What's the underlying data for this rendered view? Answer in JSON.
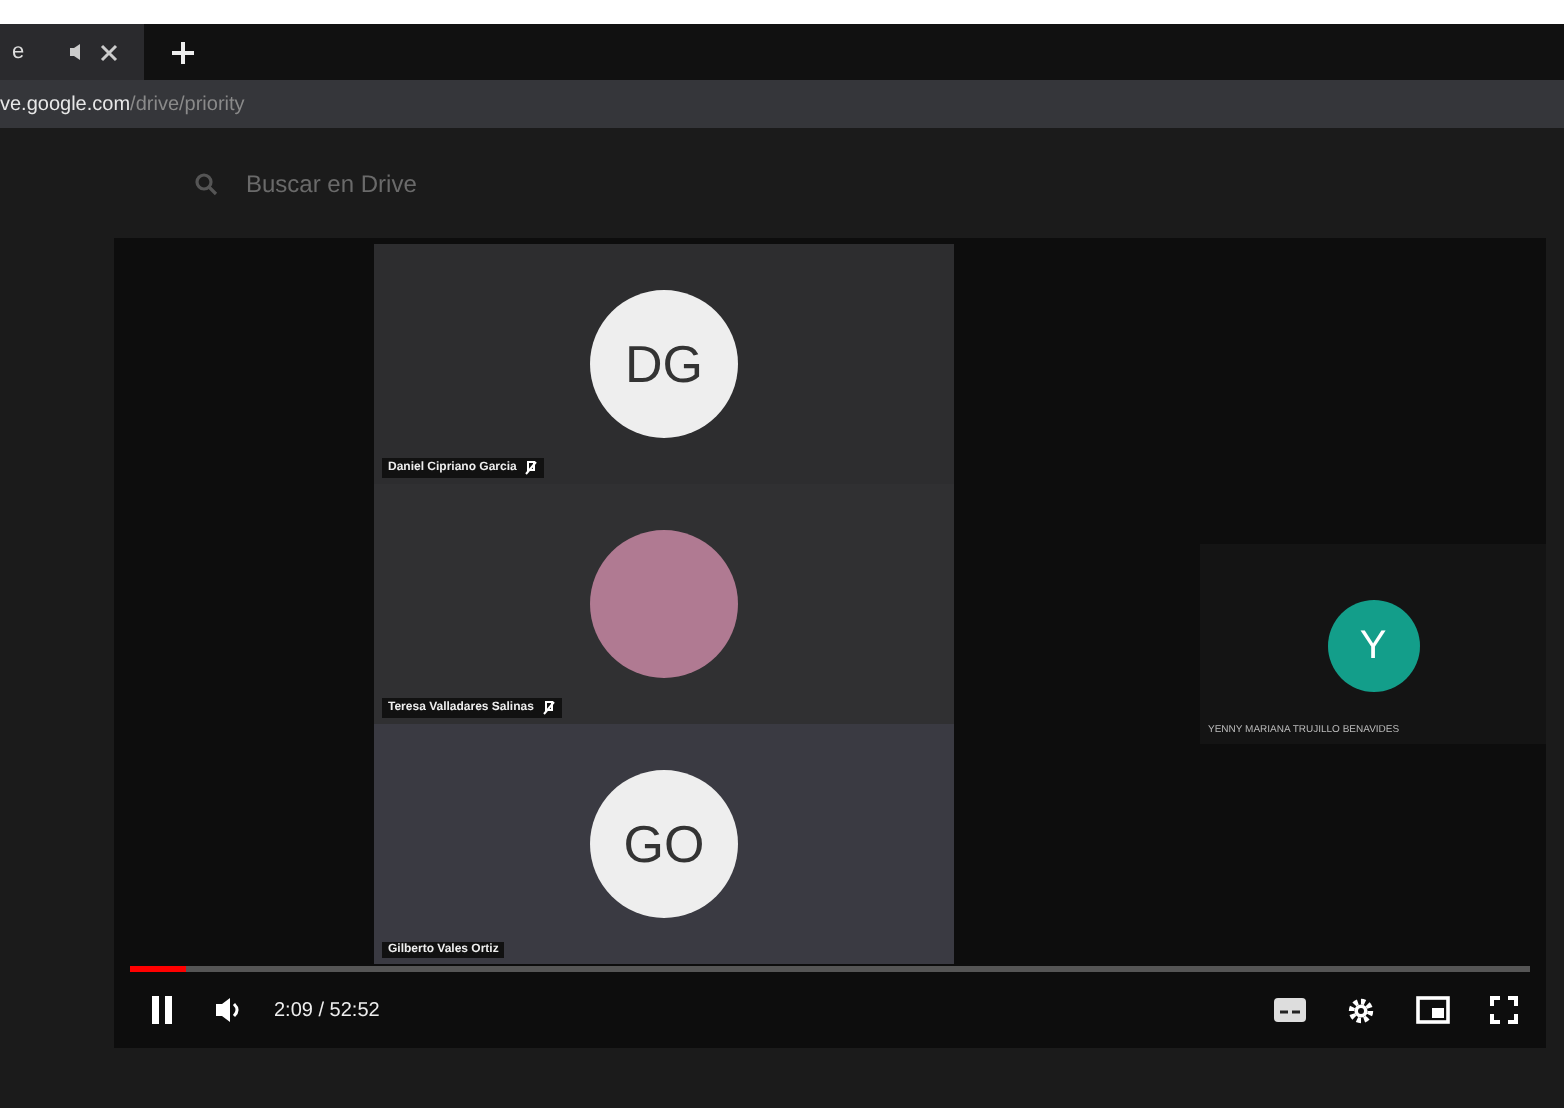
{
  "browser": {
    "tab_title": "e",
    "url_host": "ve.google.com",
    "url_path": "/drive/priority"
  },
  "drive": {
    "search_placeholder": "Buscar en Drive"
  },
  "video": {
    "tiles": [
      {
        "kind": "initials",
        "initials": "DG",
        "name": "Daniel Cipriano Garcia",
        "muted": true
      },
      {
        "kind": "photo",
        "name": "Teresa Valladares Salinas",
        "muted": true
      },
      {
        "kind": "initials",
        "initials": "GO",
        "name": "Gilberto Vales Ortiz",
        "muted": false
      }
    ],
    "side_tile": {
      "initials": "Y",
      "name": "YENNY MARIANA TRUJILLO BENAVIDES",
      "color": "#139e8a"
    },
    "player": {
      "playing": true,
      "time": "2:09 / 52:52",
      "level": 0.04
    }
  }
}
